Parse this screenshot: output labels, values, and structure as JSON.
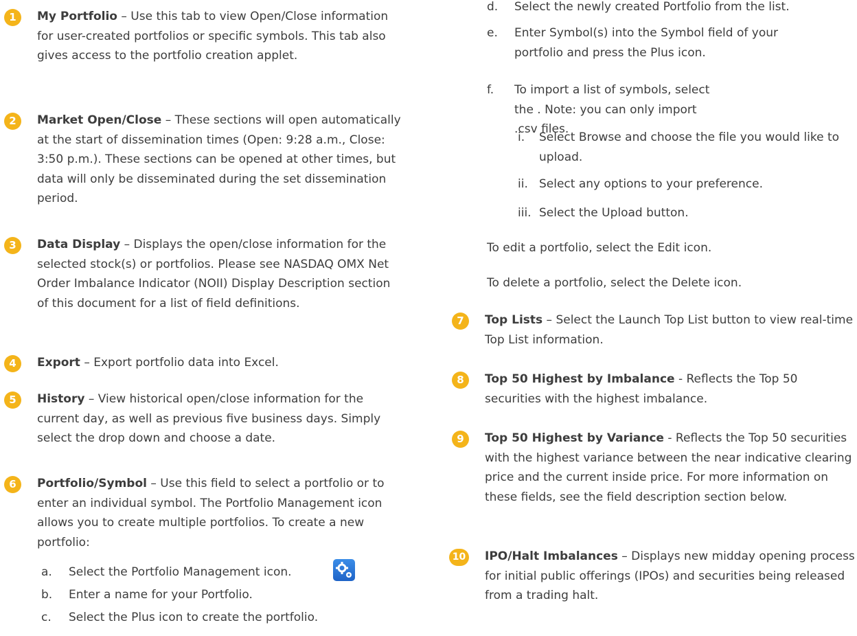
{
  "left": {
    "items": [
      {
        "num": "1",
        "title": "My Portfolio",
        "desc": " – Use this tab to view Open/Close information for user-created portfolios or specific symbols. This tab also gives access to the portfolio creation applet."
      },
      {
        "num": "2",
        "title": "Market Open/Close",
        "desc": " – These sections will open automatically at the start of dissemination times (Open: 9:28 a.m., Close: 3:50 p.m.). These sections can be opened at other times, but data will only be disseminated during the set dissemination period."
      },
      {
        "num": "3",
        "title": "Data Display",
        "desc": " – Displays the open/close information for the selected stock(s) or portfolios. Please see NASDAQ OMX Net Order Imbalance Indicator (NOII) Display Description section of this document for a list of field definitions."
      },
      {
        "num": "4",
        "title": "Export",
        "desc": " – Export portfolio data into Excel."
      },
      {
        "num": "5",
        "title": "History",
        "desc": " – View historical open/close information for the current day, as well as previous five business days. Simply select the drop down and choose a date."
      },
      {
        "num": "6",
        "title": "Portfolio/Symbol",
        "desc": " – Use this field to select a portfolio or to enter an individual symbol. The Portfolio Management icon allows you to create multiple portfolios. To create a new portfolio:"
      }
    ],
    "steps": [
      {
        "mark": "a.",
        "text": "Select the Portfolio Management icon."
      },
      {
        "mark": "b.",
        "text": "Enter a name for your Portfolio."
      },
      {
        "mark": "c.",
        "text": "Select the Plus icon to create the portfolio."
      }
    ]
  },
  "right": {
    "steps": [
      {
        "mark": "d.",
        "text": "Select the newly created Portfolio from the list."
      },
      {
        "mark": "e.",
        "text": "Enter Symbol(s) into the Symbol field of your portfolio and press the Plus icon."
      },
      {
        "mark": "f.",
        "text": "To import a list of symbols, select the . Note: you can only import .csv files."
      }
    ],
    "substeps": [
      {
        "mark": "i.",
        "text": "Select Browse and choose the file you would like to upload."
      },
      {
        "mark": "ii.",
        "text": "Select any options to your preference."
      },
      {
        "mark": "iii.",
        "text": "Select the Upload button."
      }
    ],
    "edit_note": "To edit a portfolio, select the Edit icon.",
    "delete_note": "To delete a portfolio, select the Delete icon.",
    "items": [
      {
        "num": "7",
        "title": "Top Lists",
        "desc": " – Select the Launch Top List button to view real-time Top List information."
      },
      {
        "num": "8",
        "title": "Top 50 Highest by Imbalance",
        "desc": " - Reflects the Top 50 securities with the highest imbalance."
      },
      {
        "num": "9",
        "title": "Top 50 Highest by Variance",
        "desc": " - Reflects the Top 50 securities with the highest variance between the near indicative clearing price and the current inside price. For more information on these fields, see the field description section below."
      },
      {
        "num": "10",
        "title": "IPO/Halt Imbalances",
        "desc": " – Displays new midday opening process for initial public offerings (IPOs) and securities being released from a trading halt."
      }
    ]
  },
  "colors": {
    "badge": "#f4b41a",
    "text": "#3d3d3d",
    "gear_icon": "#2b76d8"
  }
}
